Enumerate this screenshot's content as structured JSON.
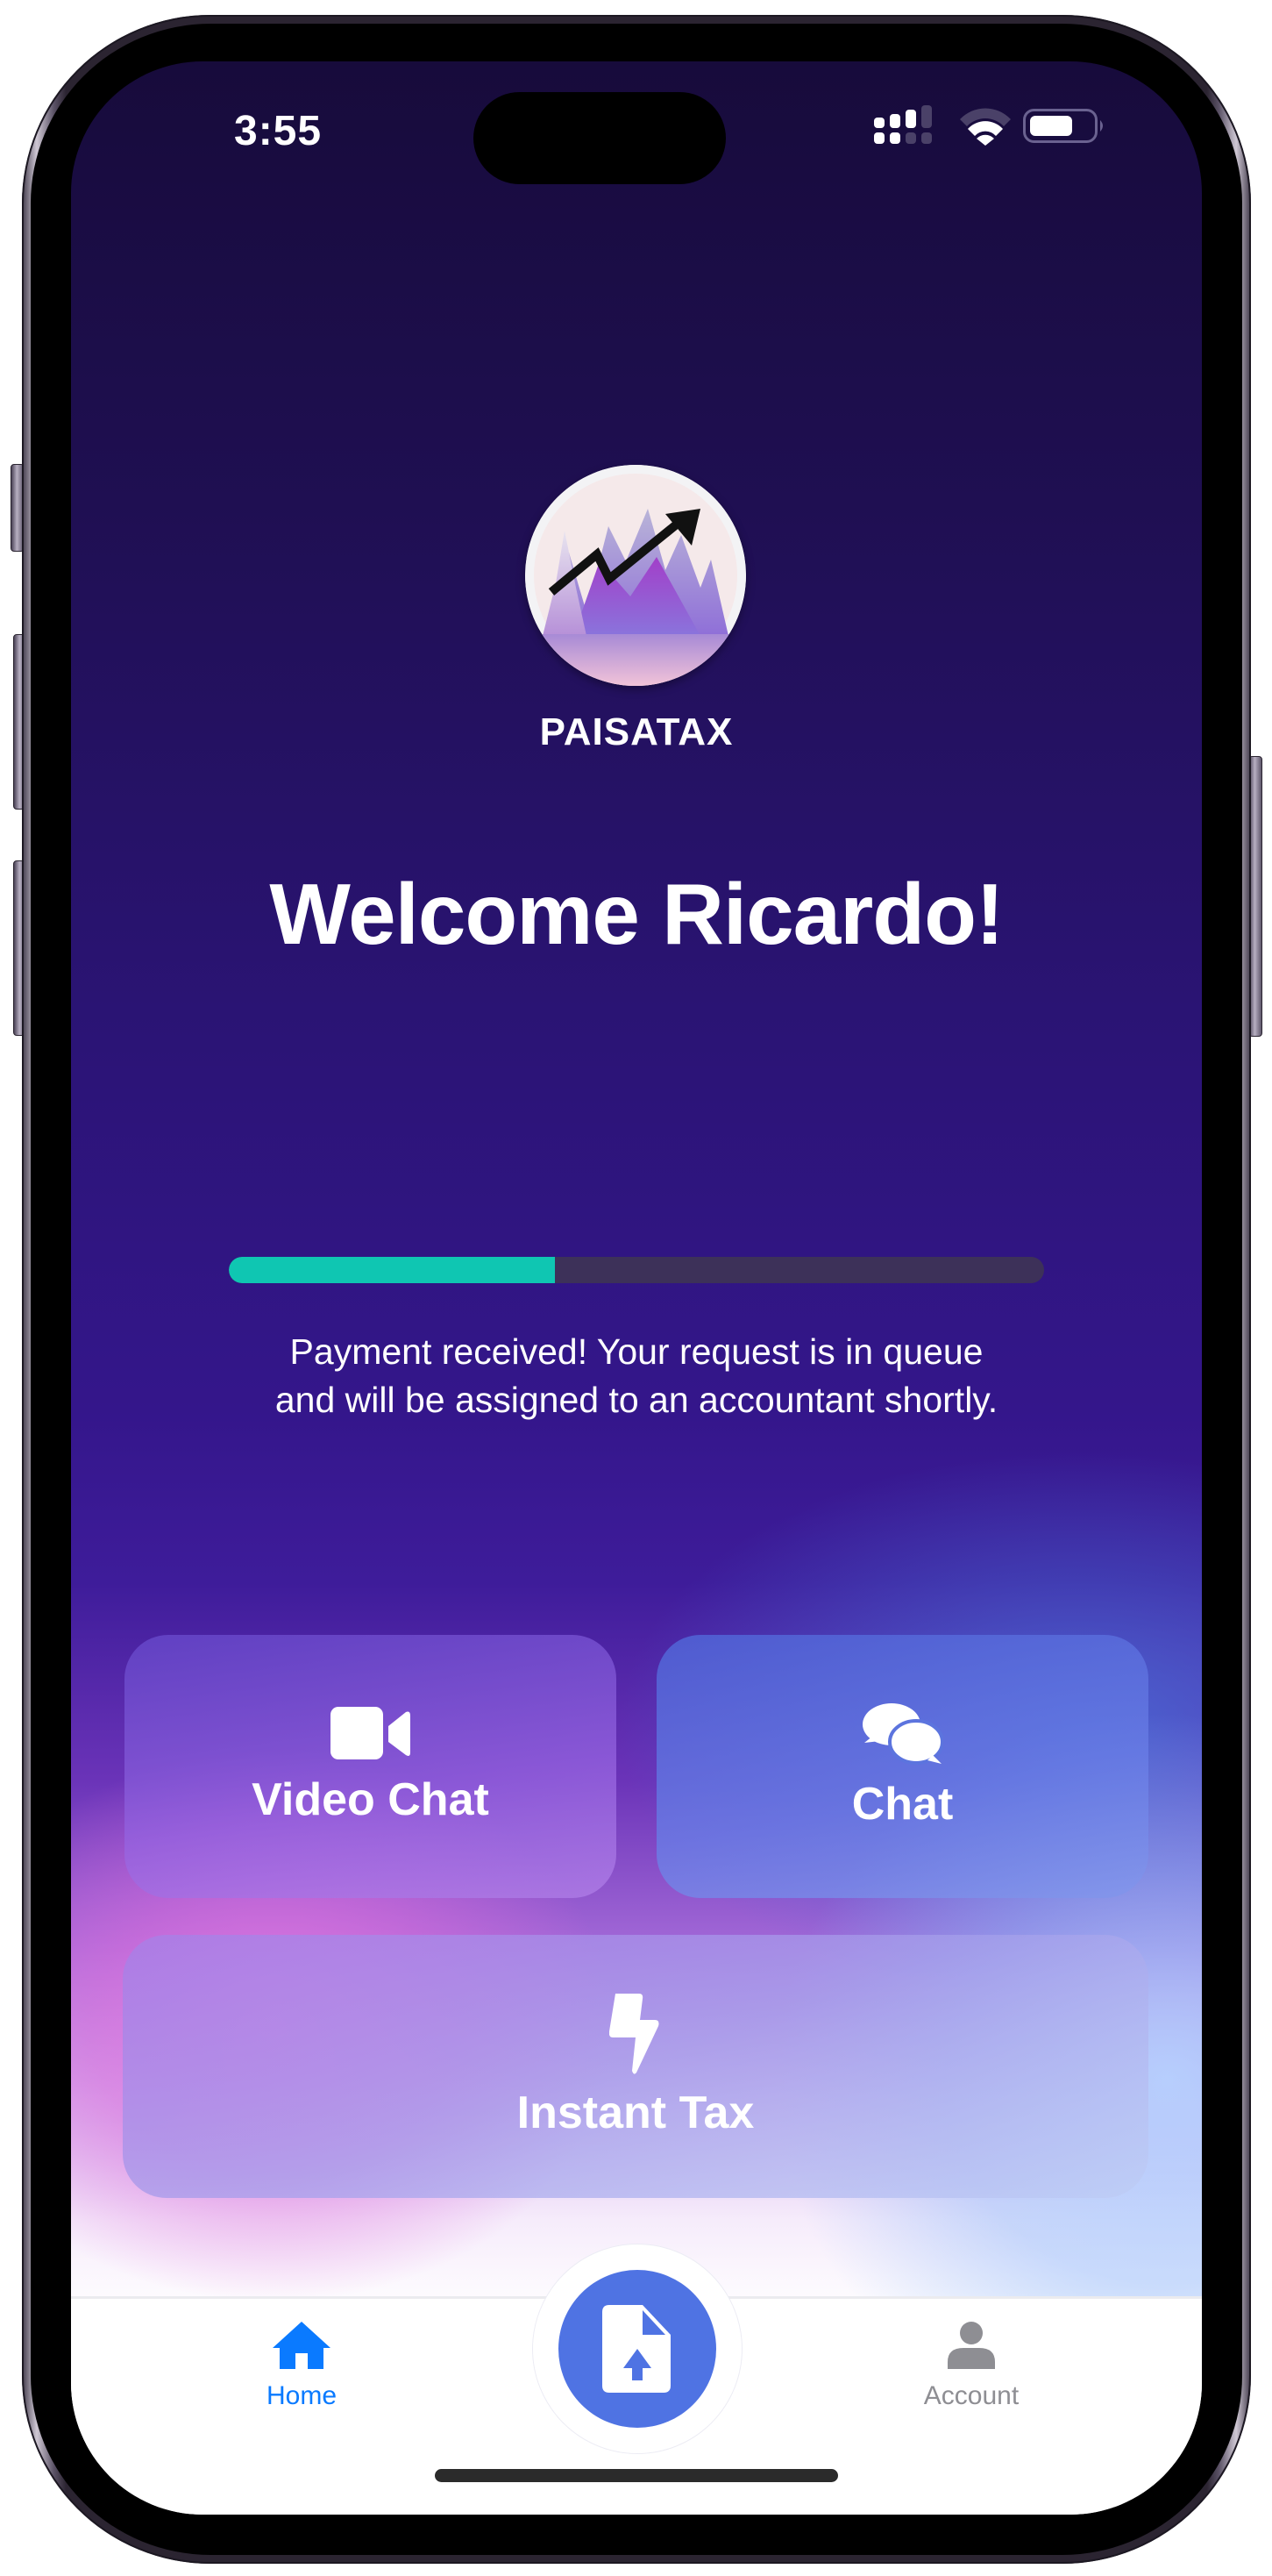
{
  "status_bar": {
    "time": "3:55",
    "signal_icon": "cellular-signal-icon",
    "wifi_icon": "wifi-icon",
    "battery_icon": "battery-icon",
    "battery_level": 0.6
  },
  "brand": {
    "name": "PAISATAX",
    "logo_icon": "mountain-chart-arrow-logo"
  },
  "welcome": {
    "title": "Welcome Ricardo!"
  },
  "progress": {
    "fraction": 0.4,
    "fill_color": "#0fc6b2",
    "track_color": "#3d3159"
  },
  "status_message": {
    "line1": "Payment received! Your request is in queue",
    "line2": "and will be assigned to an accountant shortly."
  },
  "actions": [
    {
      "label": "Video Chat",
      "icon": "video-camera-icon"
    },
    {
      "label": "Chat",
      "icon": "chat-bubbles-icon"
    },
    {
      "label": "Instant Tax",
      "icon": "lightning-bolt-icon"
    }
  ],
  "tab_bar": {
    "items": [
      {
        "label": "Home",
        "icon": "home-icon",
        "active": true,
        "color": "#0a7aff"
      },
      {
        "label": "Account",
        "icon": "person-icon",
        "active": false,
        "color": "#8e8e93"
      }
    ],
    "center_button": {
      "icon": "document-upload-icon",
      "color": "#4f73e3"
    }
  }
}
